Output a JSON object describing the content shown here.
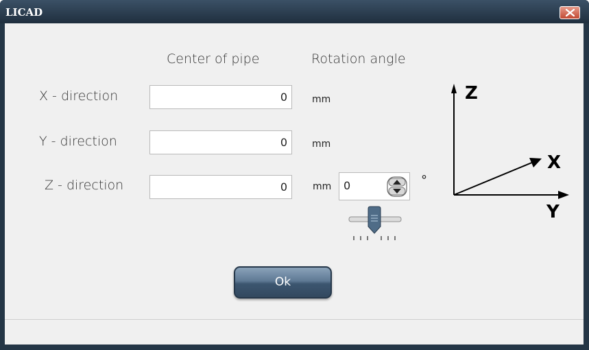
{
  "window": {
    "title": "LICAD",
    "close_icon": "close-icon"
  },
  "headers": {
    "center_of_pipe": "Center of pipe",
    "rotation_angle": "Rotation angle"
  },
  "rows": [
    {
      "label": "X - direction",
      "value": "0",
      "unit": "mm"
    },
    {
      "label": "Y - direction",
      "value": "0",
      "unit": "mm"
    },
    {
      "label": "Z - direction",
      "value": "0",
      "unit": "mm"
    }
  ],
  "rotation": {
    "value": "0",
    "unit": "°"
  },
  "axes": {
    "z": "Z",
    "x": "X",
    "y": "Y"
  },
  "ok_button": {
    "label": "Ok"
  },
  "colors": {
    "frame": "#243646",
    "client": "#f0f0f0",
    "close": "#c24a33",
    "ok": "#4a6680"
  }
}
